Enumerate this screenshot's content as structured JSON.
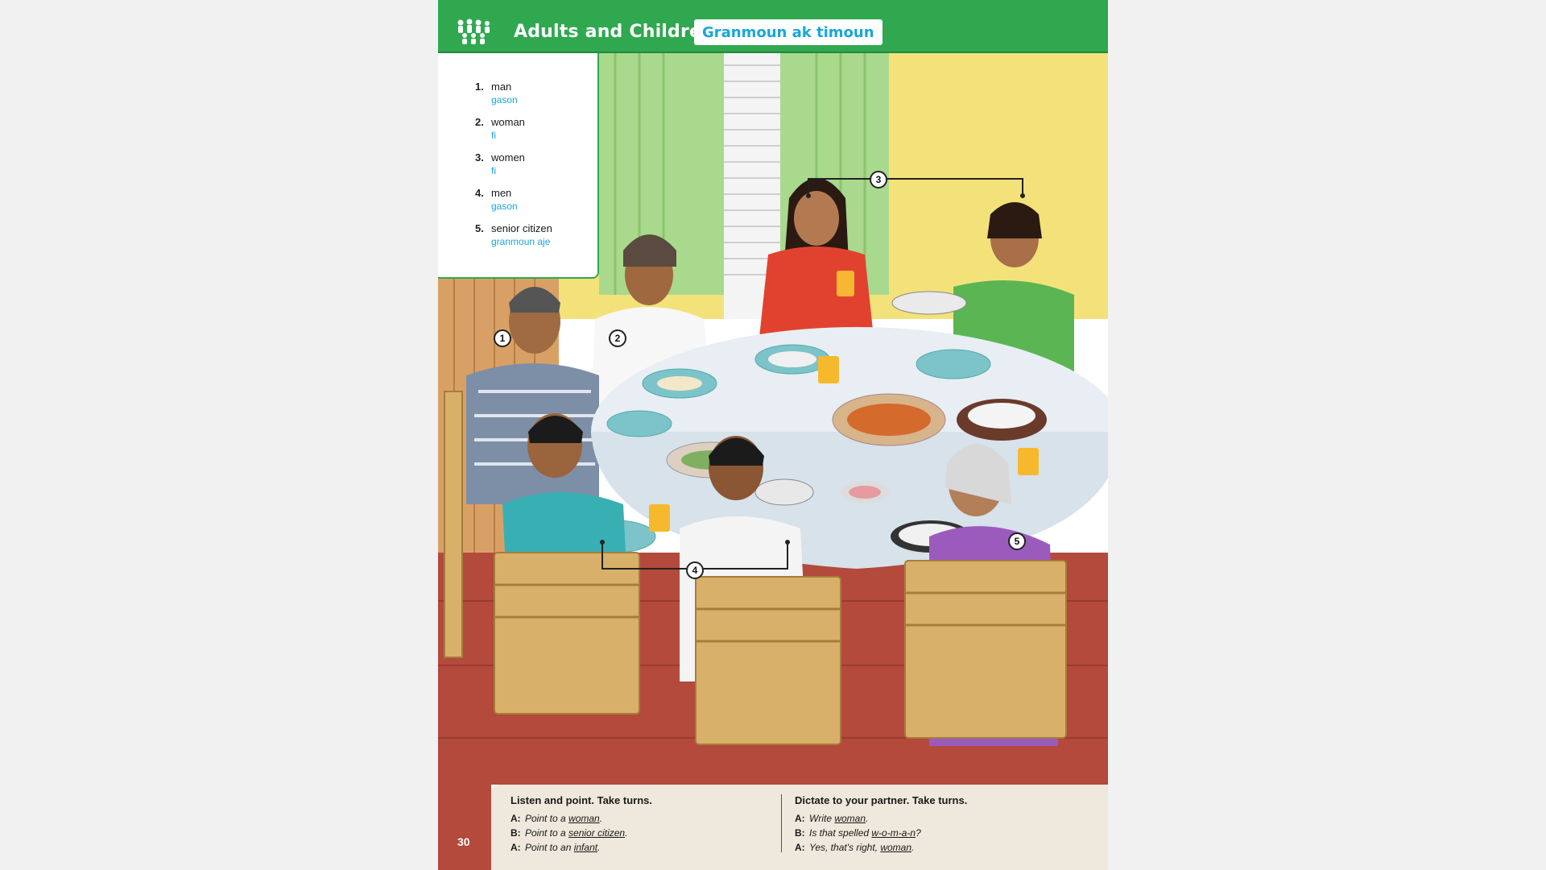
{
  "header": {
    "title": "Adults and Children",
    "translation": "Granmoun ak timoun",
    "icon": "people-group-icon"
  },
  "vocabulary": [
    {
      "num": "1.",
      "en": "man",
      "ht": "gason"
    },
    {
      "num": "2.",
      "en": "woman",
      "ht": "fi"
    },
    {
      "num": "3.",
      "en": "women",
      "ht": "fi"
    },
    {
      "num": "4.",
      "en": "men",
      "ht": "gason"
    },
    {
      "num": "5.",
      "en": "senior citizen",
      "ht": "granmoun aje"
    }
  ],
  "callouts": [
    "1",
    "2",
    "3",
    "4",
    "5"
  ],
  "exercises": {
    "left": {
      "heading": "Listen and point. Take turns.",
      "lines": [
        {
          "speaker": "A:",
          "text": "Point to a ",
          "under": "woman",
          "end": "."
        },
        {
          "speaker": "B:",
          "text": "Point to a ",
          "under": "senior citizen",
          "end": "."
        },
        {
          "speaker": "A:",
          "text": "Point to an ",
          "under": "infant",
          "end": "."
        }
      ]
    },
    "right": {
      "heading": "Dictate to your partner. Take turns.",
      "lines": [
        {
          "speaker": "A:",
          "text": "Write ",
          "under": "woman",
          "end": "."
        },
        {
          "speaker": "B:",
          "text": "Is that spelled ",
          "under": "w-o-m-a-n",
          "end": "?"
        },
        {
          "speaker": "A:",
          "text": "Yes, that's right, ",
          "under": "woman",
          "end": "."
        }
      ]
    }
  },
  "page_number": "30",
  "colors": {
    "header_green": "#2fa84f",
    "translation_blue": "#19a6d9",
    "wall_yellow": "#f3e27a",
    "curtain_green": "#a9d98c",
    "floor_red": "#b34a3c",
    "panel_beige": "#efe8dc"
  }
}
